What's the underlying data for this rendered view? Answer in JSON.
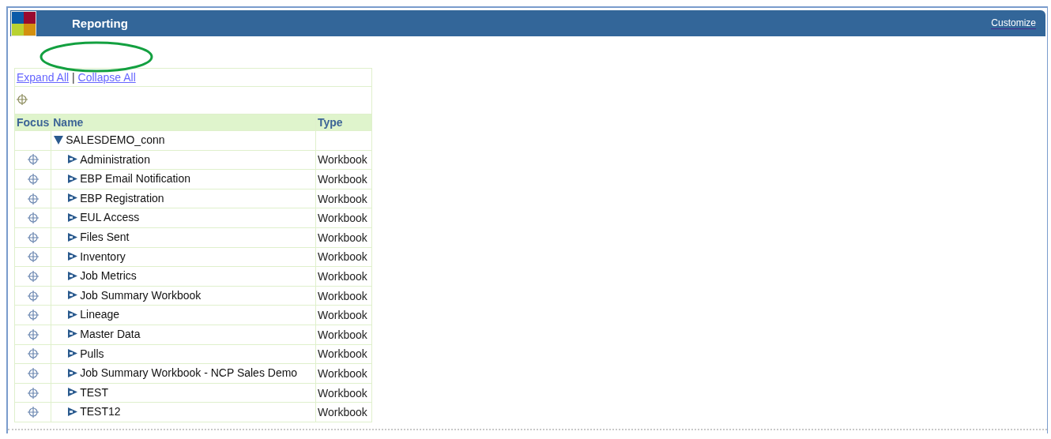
{
  "header": {
    "title": "Reporting",
    "customize_link": "Customize"
  },
  "tree_links": {
    "expand_all": "Expand All",
    "separator": "|",
    "collapse_all": "Collapse All"
  },
  "table": {
    "columns": [
      "Focus",
      "Name",
      "Type"
    ],
    "rows": [
      {
        "name": "SALESDEMO_conn",
        "type": "",
        "expanded": true,
        "children": [
          {
            "name": "Administration",
            "type": "Workbook",
            "expanded": false
          },
          {
            "name": "EBP Email Notification",
            "type": "Workbook",
            "expanded": false
          },
          {
            "name": "EBP Registration",
            "type": "Workbook",
            "expanded": false
          },
          {
            "name": "EUL Access",
            "type": "Workbook",
            "expanded": false
          },
          {
            "name": "Files Sent",
            "type": "Workbook",
            "expanded": false
          },
          {
            "name": "Inventory",
            "type": "Workbook",
            "expanded": false
          },
          {
            "name": "Job Metrics",
            "type": "Workbook",
            "expanded": false
          },
          {
            "name": "Job Summary Workbook",
            "type": "Workbook",
            "expanded": false
          },
          {
            "name": "Lineage",
            "type": "Workbook",
            "expanded": false
          },
          {
            "name": "Master Data",
            "type": "Workbook",
            "expanded": false
          },
          {
            "name": "Pulls",
            "type": "Workbook",
            "expanded": false
          },
          {
            "name": "Job Summary Workbook - NCP Sales Demo",
            "type": "Workbook",
            "expanded": false
          },
          {
            "name": "TEST",
            "type": "Workbook",
            "expanded": false
          },
          {
            "name": "TEST12",
            "type": "Workbook",
            "expanded": false
          }
        ]
      }
    ]
  }
}
